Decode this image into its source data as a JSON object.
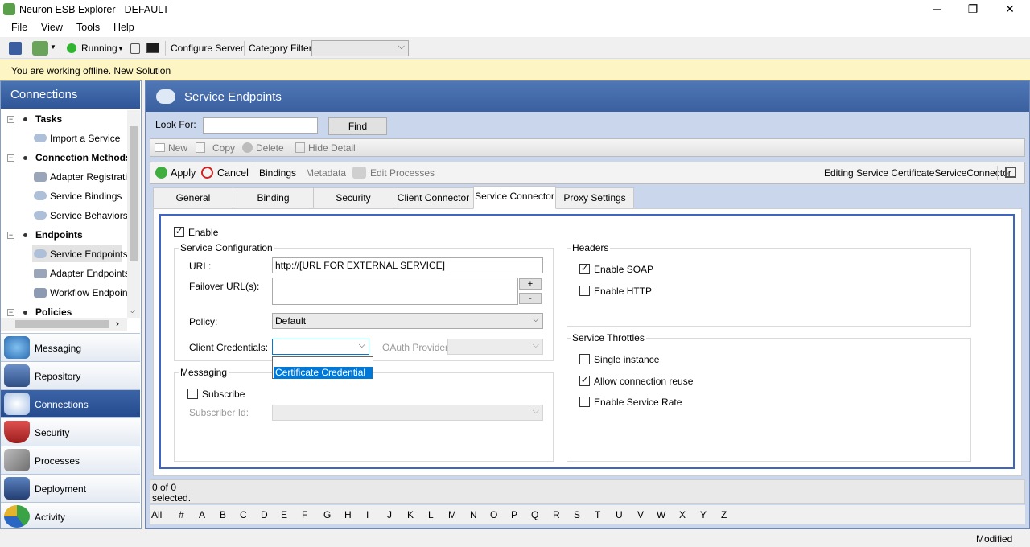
{
  "window": {
    "title": "Neuron ESB Explorer - DEFAULT",
    "minimize": "─",
    "maximize": "❐",
    "close": "✕"
  },
  "menu": [
    "File",
    "View",
    "Tools",
    "Help"
  ],
  "toolbar": {
    "status": "Running",
    "configure": "Configure Server",
    "category_filter": "Category Filter",
    "category_value": ""
  },
  "infobar": "You are working offline. New Solution",
  "sidebar": {
    "header": "Connections",
    "tree": [
      {
        "label": "Tasks",
        "bold": true
      },
      {
        "label": "Import a Service"
      },
      {
        "label": "Connection Methods",
        "bold": true
      },
      {
        "label": "Adapter Registratio"
      },
      {
        "label": "Service Bindings"
      },
      {
        "label": "Service Behaviors"
      },
      {
        "label": "Endpoints",
        "bold": true
      },
      {
        "label": "Service Endpoints"
      },
      {
        "label": "Adapter Endpoints"
      },
      {
        "label": "Workflow Endpoints"
      },
      {
        "label": "Policies",
        "bold": true
      }
    ],
    "nav": [
      "Messaging",
      "Repository",
      "Connections",
      "Security",
      "Processes",
      "Deployment",
      "Activity"
    ]
  },
  "main": {
    "title": "Service Endpoints",
    "look_for": "Look For:",
    "look_value": "",
    "find": "Find",
    "cmd1": {
      "new": "New",
      "copy": "Copy",
      "delete": "Delete",
      "hide": "Hide Detail"
    },
    "cmd2": {
      "apply": "Apply",
      "cancel": "Cancel",
      "bindings": "Bindings",
      "metadata": "Metadata",
      "edit_processes": "Edit Processes",
      "editing": "Editing Service CertificateServiceConnector"
    },
    "tabs": [
      "General",
      "Binding",
      "Security",
      "Client Connector",
      "Service Connector",
      "Proxy Settings"
    ],
    "form": {
      "enable": "Enable",
      "service_config": "Service Configuration",
      "url_label": "URL:",
      "url_value": "http://[URL FOR EXTERNAL SERVICE]",
      "failover_label": "Failover URL(s):",
      "plus": "+",
      "minus": "-",
      "policy_label": "Policy:",
      "policy_value": "Default",
      "client_cred_label": "Client Credentials:",
      "client_cred_value": "",
      "oauth_label": "OAuth Provider:",
      "dropdown_option": "Certificate Credential",
      "messaging": "Messaging",
      "subscribe": "Subscribe",
      "subscriber_id": "Subscriber Id:",
      "headers": "Headers",
      "enable_soap": "Enable SOAP",
      "enable_http": "Enable HTTP",
      "throttles": "Service Throttles",
      "single_instance": "Single instance",
      "allow_reuse": "Allow connection reuse",
      "enable_rate": "Enable Service Rate"
    },
    "status_line1": "0 of 0",
    "status_line2": "selected.",
    "alphabet": [
      "All",
      "#",
      "A",
      "B",
      "C",
      "D",
      "E",
      "F",
      "G",
      "H",
      "I",
      "J",
      "K",
      "L",
      "M",
      "N",
      "O",
      "P",
      "Q",
      "R",
      "S",
      "T",
      "U",
      "V",
      "W",
      "X",
      "Y",
      "Z"
    ]
  },
  "statusbar": "Modified"
}
